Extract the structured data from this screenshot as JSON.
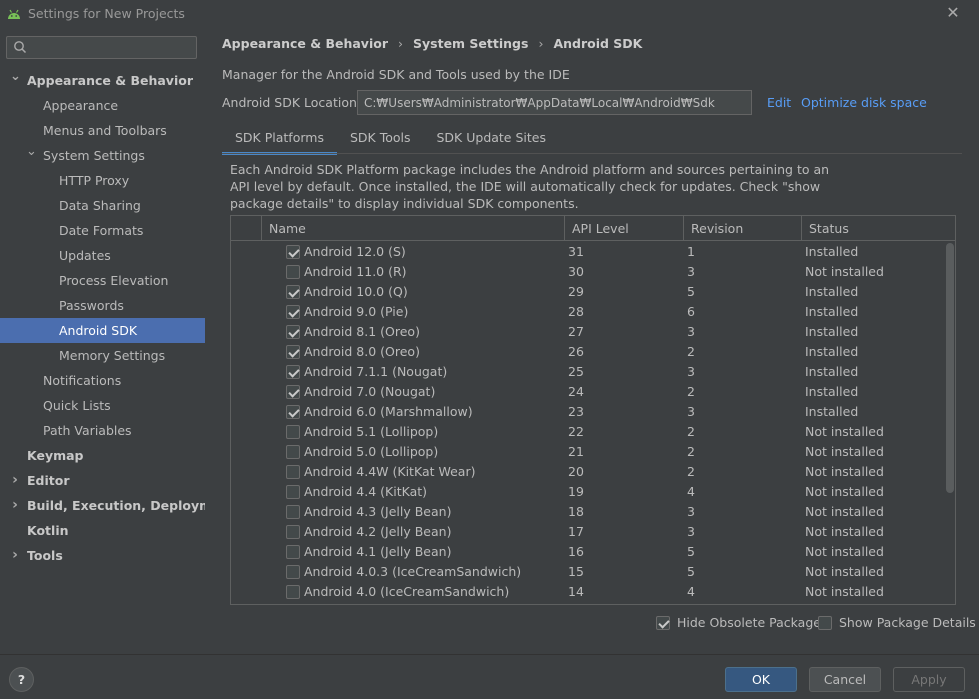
{
  "window": {
    "title": "Settings for New Projects"
  },
  "search": {
    "placeholder": ""
  },
  "sidebar": {
    "items": [
      {
        "label": "Appearance & Behavior",
        "bold": true,
        "arrow": "down"
      },
      {
        "label": "Appearance"
      },
      {
        "label": "Menus and Toolbars"
      },
      {
        "label": "System Settings",
        "arrow": "down"
      },
      {
        "label": "HTTP Proxy"
      },
      {
        "label": "Data Sharing"
      },
      {
        "label": "Date Formats"
      },
      {
        "label": "Updates"
      },
      {
        "label": "Process Elevation"
      },
      {
        "label": "Passwords"
      },
      {
        "label": "Android SDK",
        "selected": true
      },
      {
        "label": "Memory Settings"
      },
      {
        "label": "Notifications"
      },
      {
        "label": "Quick Lists"
      },
      {
        "label": "Path Variables"
      },
      {
        "label": "Keymap",
        "bold": true
      },
      {
        "label": "Editor",
        "bold": true,
        "arrow": "right"
      },
      {
        "label": "Build, Execution, Deployment",
        "bold": true,
        "arrow": "right"
      },
      {
        "label": "Kotlin",
        "bold": true
      },
      {
        "label": "Tools",
        "bold": true,
        "arrow": "right"
      }
    ]
  },
  "breadcrumb": [
    "Appearance & Behavior",
    "System Settings",
    "Android SDK"
  ],
  "main": {
    "description": "Manager for the Android SDK and Tools used by the IDE",
    "location_label": "Android SDK Location:",
    "location_value": "C:₩Users₩Administrator₩AppData₩Local₩Android₩Sdk",
    "edit_link": "Edit",
    "optimize_link": "Optimize disk space",
    "tabs": [
      "SDK Platforms",
      "SDK Tools",
      "SDK Update Sites"
    ],
    "info_text": "Each Android SDK Platform package includes the Android platform and sources pertaining to an API level by default. Once installed, the IDE will automatically check for updates. Check \"show package details\" to display individual SDK components."
  },
  "table": {
    "columns": [
      "Name",
      "API Level",
      "Revision",
      "Status"
    ],
    "rows": [
      {
        "checked": true,
        "name": "Android 12.0 (S)",
        "api": "31",
        "rev": "1",
        "status": "Installed"
      },
      {
        "checked": false,
        "name": "Android 11.0 (R)",
        "api": "30",
        "rev": "3",
        "status": "Not installed"
      },
      {
        "checked": true,
        "name": "Android 10.0 (Q)",
        "api": "29",
        "rev": "5",
        "status": "Installed"
      },
      {
        "checked": true,
        "name": "Android 9.0 (Pie)",
        "api": "28",
        "rev": "6",
        "status": "Installed"
      },
      {
        "checked": true,
        "name": "Android 8.1 (Oreo)",
        "api": "27",
        "rev": "3",
        "status": "Installed"
      },
      {
        "checked": true,
        "name": "Android 8.0 (Oreo)",
        "api": "26",
        "rev": "2",
        "status": "Installed"
      },
      {
        "checked": true,
        "name": "Android 7.1.1 (Nougat)",
        "api": "25",
        "rev": "3",
        "status": "Installed"
      },
      {
        "checked": true,
        "name": "Android 7.0 (Nougat)",
        "api": "24",
        "rev": "2",
        "status": "Installed"
      },
      {
        "checked": true,
        "name": "Android 6.0 (Marshmallow)",
        "api": "23",
        "rev": "3",
        "status": "Installed"
      },
      {
        "checked": false,
        "name": "Android 5.1 (Lollipop)",
        "api": "22",
        "rev": "2",
        "status": "Not installed"
      },
      {
        "checked": false,
        "name": "Android 5.0 (Lollipop)",
        "api": "21",
        "rev": "2",
        "status": "Not installed"
      },
      {
        "checked": false,
        "name": "Android 4.4W (KitKat Wear)",
        "api": "20",
        "rev": "2",
        "status": "Not installed"
      },
      {
        "checked": false,
        "name": "Android 4.4 (KitKat)",
        "api": "19",
        "rev": "4",
        "status": "Not installed"
      },
      {
        "checked": false,
        "name": "Android 4.3 (Jelly Bean)",
        "api": "18",
        "rev": "3",
        "status": "Not installed"
      },
      {
        "checked": false,
        "name": "Android 4.2 (Jelly Bean)",
        "api": "17",
        "rev": "3",
        "status": "Not installed"
      },
      {
        "checked": false,
        "name": "Android 4.1 (Jelly Bean)",
        "api": "16",
        "rev": "5",
        "status": "Not installed"
      },
      {
        "checked": false,
        "name": "Android 4.0.3 (IceCreamSandwich)",
        "api": "15",
        "rev": "5",
        "status": "Not installed"
      },
      {
        "checked": false,
        "name": "Android 4.0 (IceCreamSandwich)",
        "api": "14",
        "rev": "4",
        "status": "Not installed"
      }
    ]
  },
  "options": {
    "hide_obsolete": {
      "label": "Hide Obsolete Packages",
      "checked": true
    },
    "show_details": {
      "label": "Show Package Details",
      "checked": false
    }
  },
  "footer": {
    "help": "?",
    "ok": "OK",
    "cancel": "Cancel",
    "apply": "Apply"
  },
  "colors": {
    "background": "#3c3f41",
    "selection": "#4b6eaf",
    "link": "#589df6",
    "tab_underline": "#4a88c7",
    "primary_button": "#365880"
  }
}
